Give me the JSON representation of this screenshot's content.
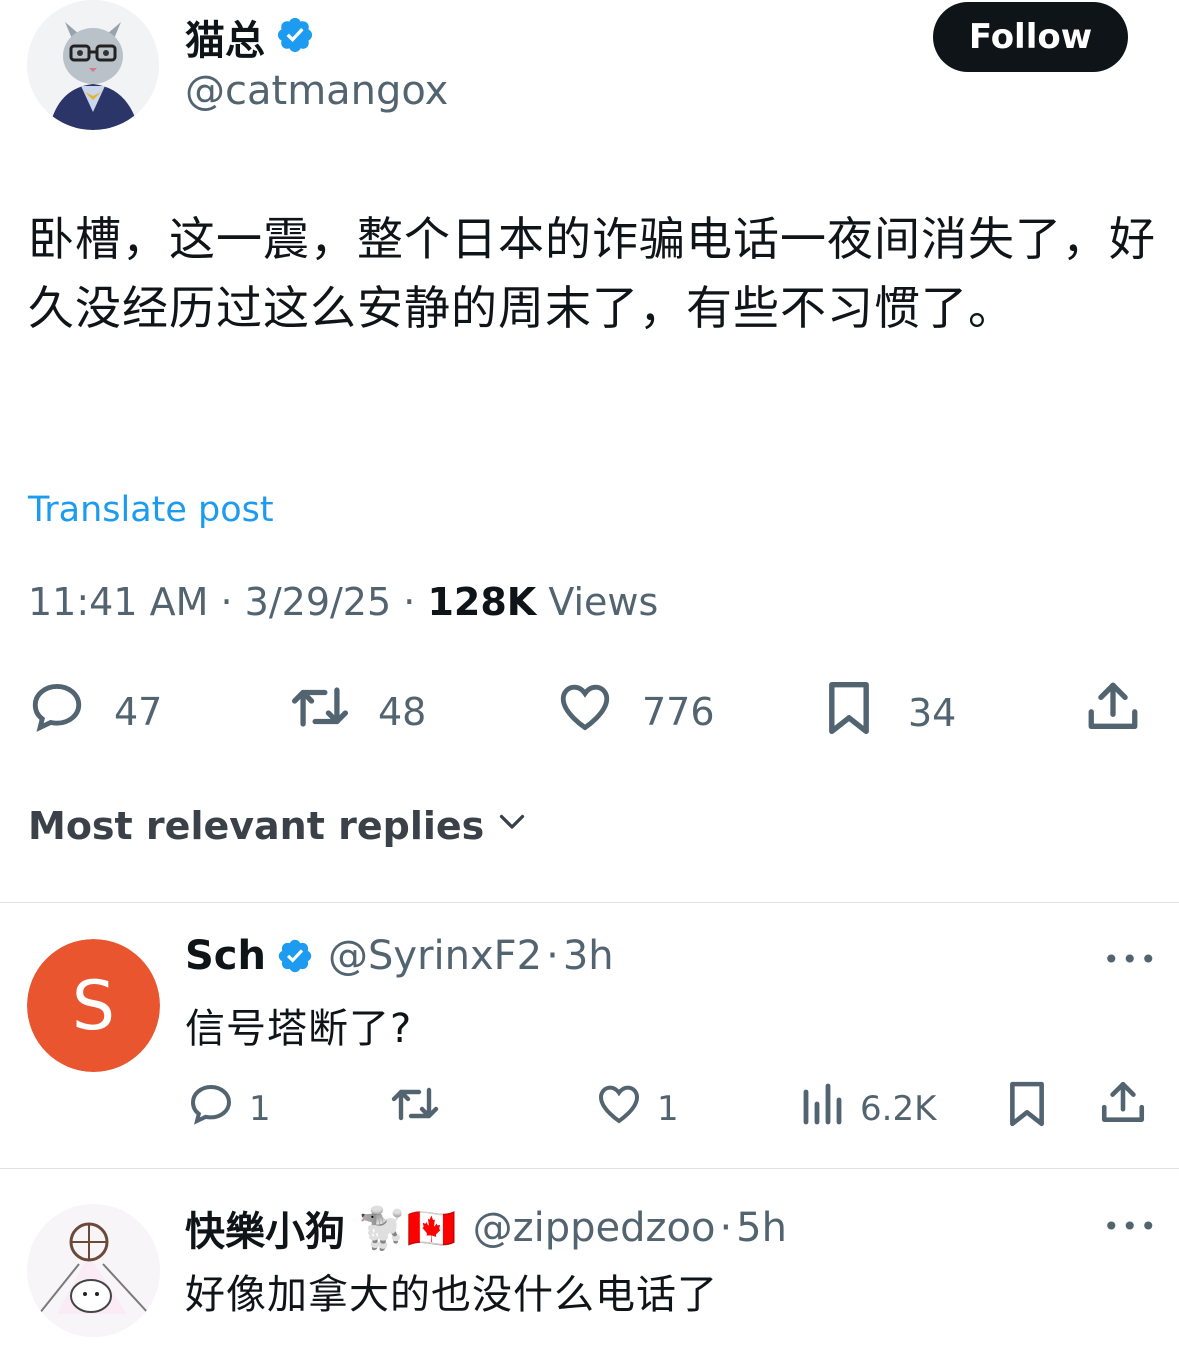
{
  "author": {
    "name": "猫总",
    "handle": "@catmangox",
    "avatar": "cat-in-suit-avatar",
    "verified": true
  },
  "follow_label": "Follow",
  "post": {
    "text": "卧槽，这一震，整个日本的诈骗电话一夜间消失了，好久没经历过这么安静的周末了，有些不习惯了。",
    "translate_label": "Translate post",
    "time": "11:41 AM",
    "date": "3/29/25",
    "views_count": "128K",
    "views_label": "Views",
    "separator": "·"
  },
  "actions": {
    "replies": "47",
    "reposts": "48",
    "likes": "776",
    "bookmarks": "34"
  },
  "replies_heading": "Most relevant replies",
  "replies": [
    {
      "name": "Sch",
      "verified": true,
      "handle": "@SyrinxF2",
      "time": "3h",
      "avatar_letter": "S",
      "avatar_color": "#e8552f",
      "text": "信号塔断了?",
      "reply_count": "1",
      "like_count": "1",
      "views": "6.2K"
    },
    {
      "name": "快樂小狗",
      "name_emoji": "🐩🇨🇦",
      "handle": "@zippedzoo",
      "time": "5h",
      "text": "好像加拿大的也没什么电话了"
    }
  ],
  "colors": {
    "accent": "#1d9bf0",
    "text": "#0f1419",
    "secondary": "#536471"
  }
}
